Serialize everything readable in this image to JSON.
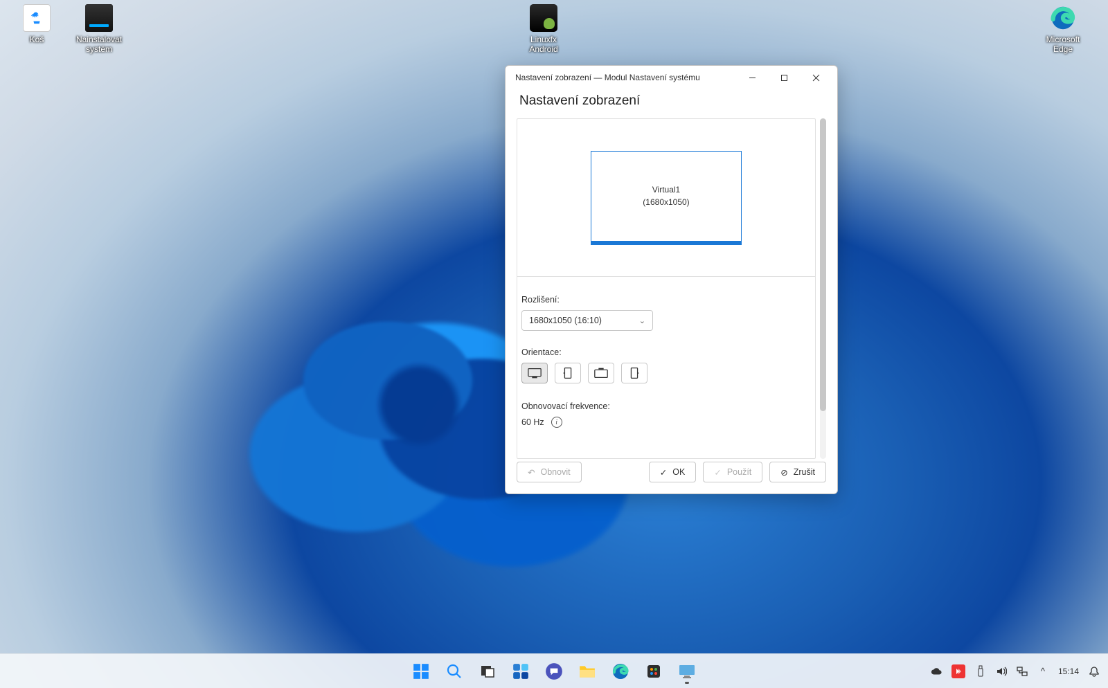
{
  "desktop_icons": {
    "trash": "Koš",
    "install_system": "Nainstalovat\nsystém",
    "linuxfx_android": "Linuxfx\nAndroid",
    "microsoft_edge": "Microsoft\nEdge"
  },
  "window": {
    "title": "Nastavení zobrazení — Modul Nastavení systému",
    "heading": "Nastavení zobrazení",
    "monitor": {
      "name": "Virtual1",
      "resolution_paren": "(1680x1050)"
    },
    "labels": {
      "resolution": "Rozlišení:",
      "orientation": "Orientace:",
      "refresh_rate": "Obnovovací frekvence:"
    },
    "resolution_value": "1680x1050 (16:10)",
    "refresh_value": "60 Hz",
    "buttons": {
      "refresh": "Obnovit",
      "ok": "OK",
      "apply": "Použít",
      "cancel": "Zrušit"
    }
  },
  "taskbar": {
    "clock": "15:14"
  }
}
